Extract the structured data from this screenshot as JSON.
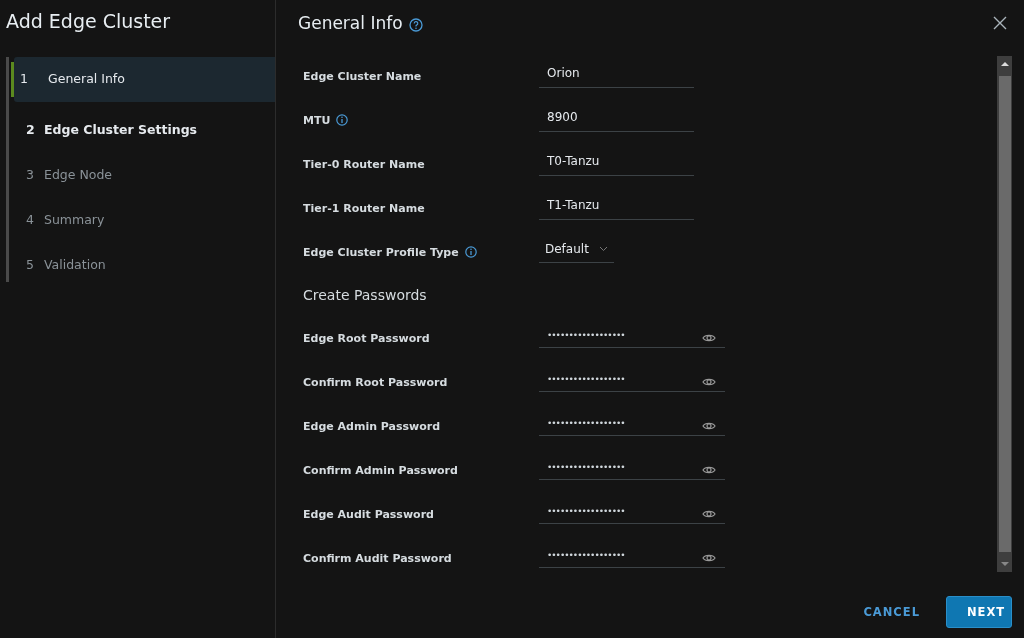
{
  "wizard": {
    "title": "Add Edge Cluster"
  },
  "steps": [
    {
      "number": "1",
      "label": "General Info",
      "selected": true,
      "disabled": false
    },
    {
      "number": "2",
      "label": "Edge Cluster Settings",
      "selected": false,
      "disabled": false
    },
    {
      "number": "3",
      "label": "Edge Node",
      "selected": false,
      "disabled": true
    },
    {
      "number": "4",
      "label": "Summary",
      "selected": false,
      "disabled": true
    },
    {
      "number": "5",
      "label": "Validation",
      "selected": false,
      "disabled": true
    }
  ],
  "page": {
    "title": "General Info",
    "help": true
  },
  "form": [
    {
      "kind": "text",
      "label": "Edge Cluster Name",
      "info": false,
      "value": "Orion"
    },
    {
      "kind": "text",
      "label": "MTU",
      "info": true,
      "value": "8900"
    },
    {
      "kind": "text",
      "label": "Tier-0 Router Name",
      "info": false,
      "value": "T0-Tanzu"
    },
    {
      "kind": "text",
      "label": "Tier-1 Router Name",
      "info": false,
      "value": "T1-Tanzu"
    },
    {
      "kind": "select",
      "label": "Edge Cluster Profile Type",
      "info": true,
      "value": "Default"
    },
    {
      "kind": "heading",
      "label": "Create Passwords"
    },
    {
      "kind": "password",
      "label": "Edge Root Password",
      "info": false,
      "value": "••••••••••••••••••"
    },
    {
      "kind": "password",
      "label": "Confirm Root Password",
      "info": false,
      "value": "••••••••••••••••••"
    },
    {
      "kind": "password",
      "label": "Edge Admin Password",
      "info": false,
      "value": "••••••••••••••••••"
    },
    {
      "kind": "password",
      "label": "Confirm Admin Password",
      "info": false,
      "value": "••••••••••••••••••"
    },
    {
      "kind": "password",
      "label": "Edge Audit Password",
      "info": false,
      "value": "••••••••••••••••••"
    },
    {
      "kind": "password",
      "label": "Confirm Audit Password",
      "info": false,
      "value": "••••••••••••••••••"
    }
  ],
  "buttons": [
    {
      "kind": "secondary",
      "label": "CANCEL"
    },
    {
      "kind": "primary",
      "label": "NEXT"
    }
  ]
}
